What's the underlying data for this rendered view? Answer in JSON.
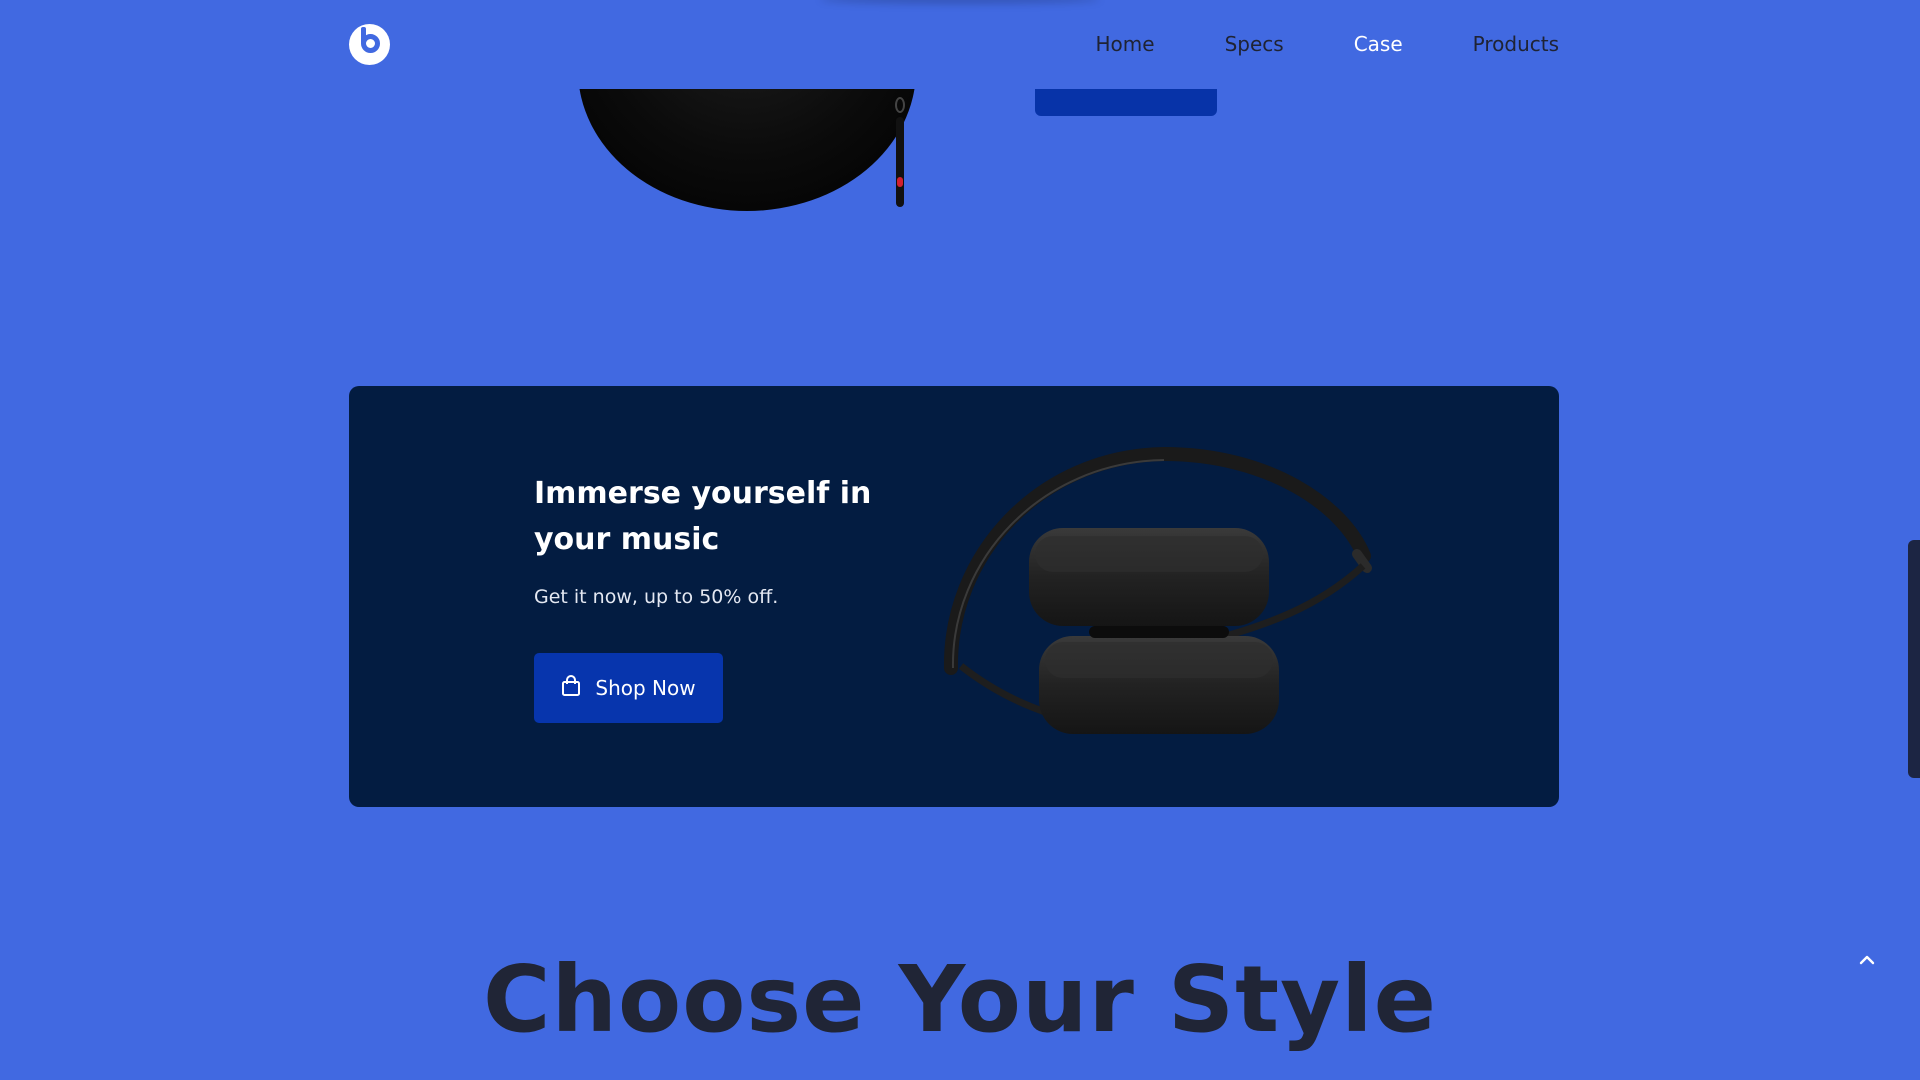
{
  "header": {
    "logo_letter": "b",
    "nav": [
      "Home",
      "Specs",
      "Case",
      "Products"
    ],
    "active_nav_index": 2
  },
  "promo": {
    "title": "Immerse yourself in your music",
    "subtitle": "Get it now, up to 50% off.",
    "button_label": "Shop Now",
    "button_icon": "shopping-bag-icon"
  },
  "section": {
    "heading": "Choose Your Style"
  },
  "colors": {
    "page_bg": "#4169e1",
    "card_bg": "#031c41",
    "button_bg": "#0735ad",
    "nav_text": "#1f2333",
    "active_nav_text": "#ffffff"
  },
  "icons": {
    "back_to_top": "chevron-up-icon"
  }
}
